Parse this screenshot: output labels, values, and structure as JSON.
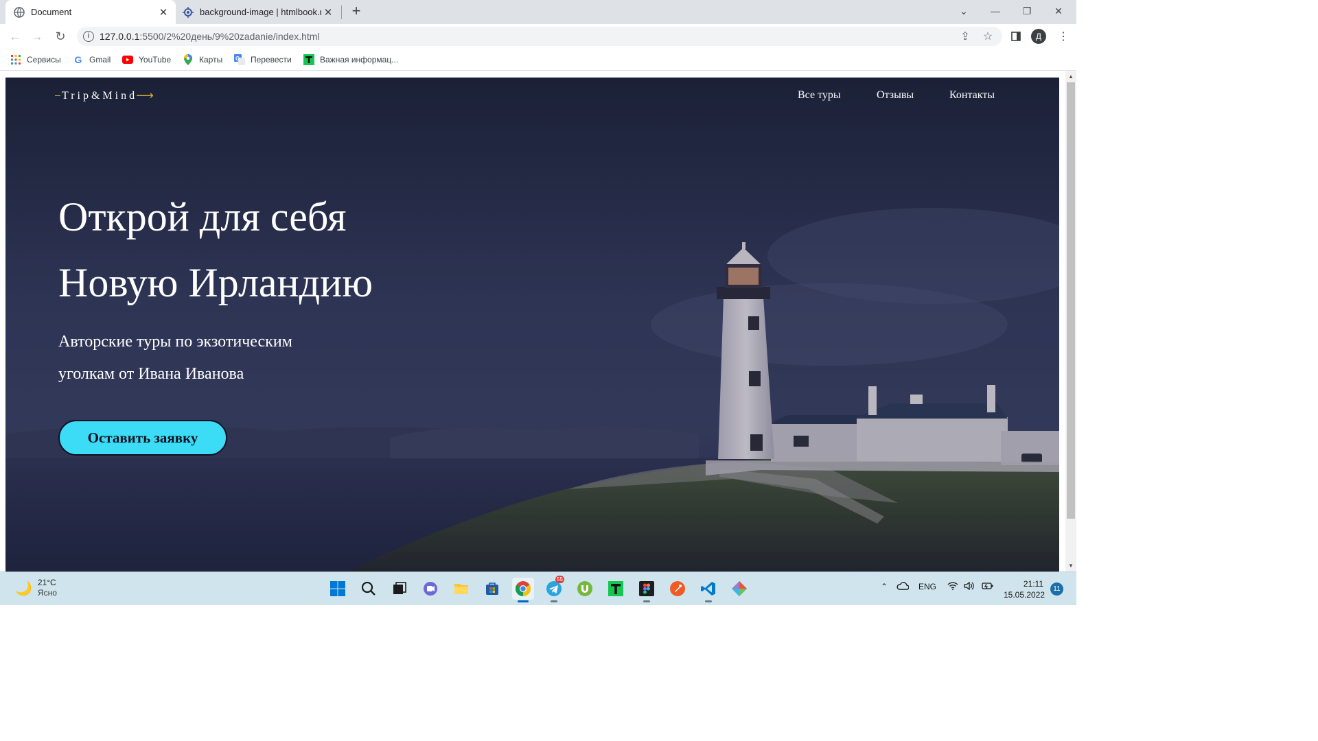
{
  "browser": {
    "tabs": [
      {
        "title": "Document",
        "active": true,
        "icon": "globe-icon"
      },
      {
        "title": "background-image | htmlbook.ru",
        "active": false,
        "icon": "htmlbook-icon"
      }
    ],
    "address": {
      "host": "127.0.0.1",
      "rest": ":5500/2%20день/9%20zadanie/index.html"
    },
    "profile_initial": "Д",
    "bookmarks": [
      {
        "label": "Сервисы",
        "icon": "apps-grid-icon"
      },
      {
        "label": "Gmail",
        "icon": "google-icon"
      },
      {
        "label": "YouTube",
        "icon": "youtube-icon"
      },
      {
        "label": "Карты",
        "icon": "maps-icon"
      },
      {
        "label": "Перевести",
        "icon": "translate-icon"
      },
      {
        "label": "Важная информац...",
        "icon": "tilda-icon"
      }
    ]
  },
  "page": {
    "logo": "Trip&Mind",
    "nav": [
      "Все туры",
      "Отзывы",
      "Контакты"
    ],
    "headline_line1": "Открой для себя",
    "headline_line2": "Новую Ирландию",
    "subtitle_line1": "Авторские туры по экзотическим",
    "subtitle_line2": "уголкам от Ивана Иванова",
    "cta": "Оставить заявку",
    "colors": {
      "cta": "#3ddcf6",
      "logo_accent": "#d4a83a",
      "hero_bg": "#252c47"
    }
  },
  "taskbar": {
    "weather_temp": "21°C",
    "weather_cond": "Ясно",
    "apps": [
      "windows-start-icon",
      "search-icon",
      "task-view-icon",
      "teams-chat-icon",
      "file-explorer-icon",
      "store-icon",
      "chrome-icon",
      "telegram-icon",
      "utorrent-icon",
      "tilda-icon",
      "figma-icon",
      "postman-icon",
      "vscode-icon",
      "git-icon"
    ],
    "telegram_badge": "55",
    "language": "ENG",
    "time": "21:11",
    "date": "15.05.2022",
    "notifications": "11"
  }
}
